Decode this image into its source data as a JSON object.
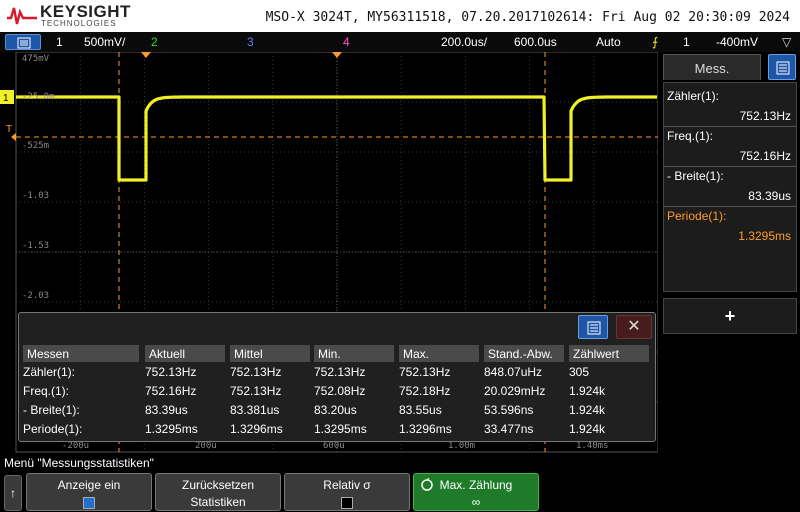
{
  "header": {
    "brand": "KEYSIGHT",
    "brand_sub": "TECHNOLOGIES",
    "device_info": "MSO-X 3024T, MY56311518, 07.20.2017102614: Fri Aug 02 20:30:09 2024"
  },
  "status": {
    "ch1": "1",
    "ch1_scale": "500mV/",
    "ch2": "2",
    "ch3": "3",
    "ch4": "4",
    "timebase": "200.0us/",
    "delay": "600.0us",
    "trigger_mode": "Auto",
    "trigger_source": "1",
    "trigger_level": "-400mV"
  },
  "plot": {
    "y_labels": [
      "475mV",
      "-25.0m",
      "-525m",
      "-1.03",
      "-1.53",
      "-2.03"
    ],
    "x_labels": [
      "-200u",
      "200u",
      "600u",
      "1.00m",
      "1.40ms"
    ],
    "ground_marker": "1",
    "trigger_marker": "T",
    "colors": {
      "trace": "#f0f028",
      "grid": "#3a3a3a",
      "trigger_line": "#ff9c28"
    }
  },
  "side_panel": {
    "tab_label": "Mess.",
    "items": [
      {
        "name": "Zähler(1):",
        "value": "752.13Hz"
      },
      {
        "name": "Freq.(1):",
        "value": "752.16Hz"
      },
      {
        "name": "- Breite(1):",
        "value": "83.39us"
      },
      {
        "name": "Periode(1):",
        "value": "1.3295ms"
      }
    ],
    "add_label": "+"
  },
  "stats": {
    "headers": [
      "Messen",
      "Aktuell",
      "Mittel",
      "Min.",
      "Max.",
      "Stand.-Abw.",
      "Zählwert"
    ],
    "rows": [
      [
        "Zähler(1):",
        "752.13Hz",
        "752.13Hz",
        "752.13Hz",
        "752.13Hz",
        "848.07uHz",
        "305"
      ],
      [
        "Freq.(1):",
        "752.16Hz",
        "752.13Hz",
        "752.08Hz",
        "752.18Hz",
        "20.029mHz",
        "1.924k"
      ],
      [
        "- Breite(1):",
        "83.39us",
        "83.381us",
        "83.20us",
        "83.55us",
        "53.596ns",
        "1.924k"
      ],
      [
        "Periode(1):",
        "1.3295ms",
        "1.3296ms",
        "1.3295ms",
        "1.3296ms",
        "33.477ns",
        "1.924k"
      ]
    ],
    "close_symbol": "✕"
  },
  "menu_title": "Menü \"Messungsstatistiken\"",
  "softkeys": {
    "back": "↑",
    "k1": {
      "l1": "Anzeige ein"
    },
    "k2": {
      "l1": "Zurücksetzen",
      "l2": "Statistiken"
    },
    "k3": {
      "l1": "Relativ σ"
    },
    "k4": {
      "l1": "Max. Zählung",
      "l2": "∞"
    }
  }
}
